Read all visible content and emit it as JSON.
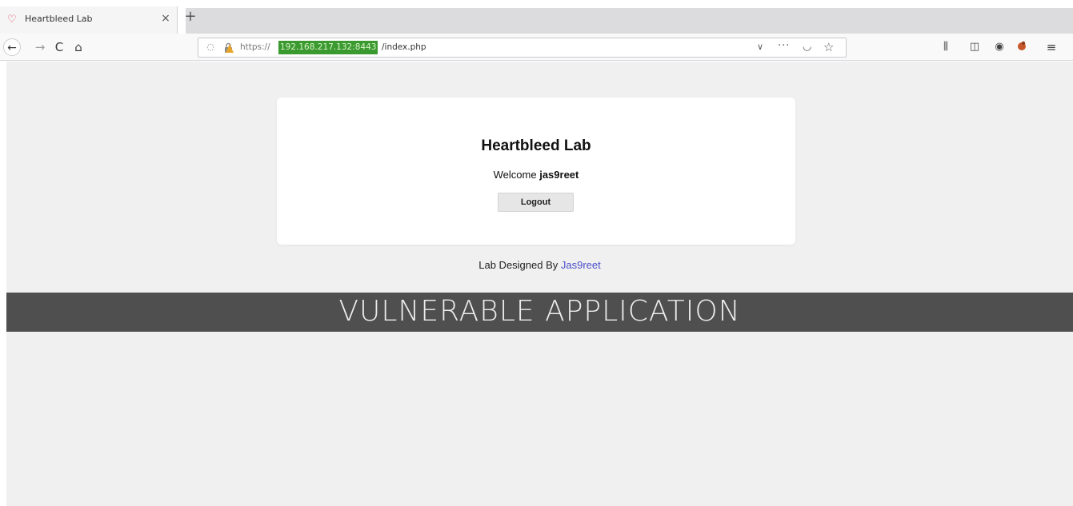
{
  "browser": {
    "tab": {
      "title": "Heartbleed Lab",
      "icon": "heart-icon",
      "close_glyph": "×"
    },
    "new_tab_glyph": "+",
    "nav": {
      "back_glyph": "←",
      "forward_glyph": "→",
      "reload_glyph": "C",
      "home_glyph": "⌂"
    },
    "url": {
      "scheme": "https://",
      "host": "192.168.217.132:8443",
      "path": "/index.php"
    },
    "toolbar_icons": [
      "library-icon",
      "sidebar-icon",
      "account-icon",
      "extension-icon",
      "menu-icon"
    ]
  },
  "page": {
    "title": "Heartbleed Lab",
    "welcome_prefix": "Welcome ",
    "username": "jas9reet",
    "logout_label": "Logout",
    "credit_prefix": "Lab Designed By ",
    "credit_link": "Jas9reet",
    "banner": "VULNERABLE APPLICATION"
  },
  "colors": {
    "url_host_highlight": "#3b9a2f",
    "banner_bg": "#4f4f4f",
    "link": "#4b4fc9"
  }
}
